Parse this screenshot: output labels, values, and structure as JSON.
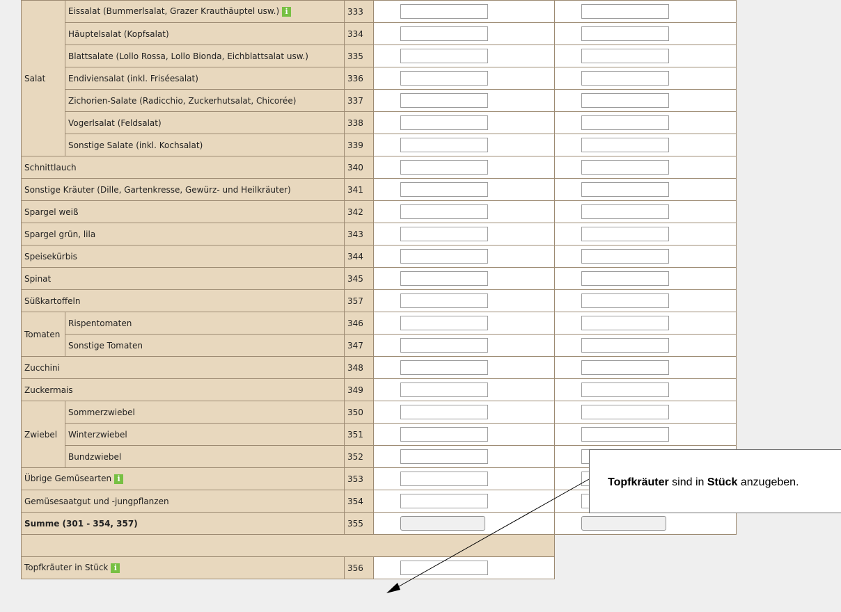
{
  "rows": {
    "salat": {
      "group_label": "Salat",
      "items": [
        {
          "label": "Eissalat (Bummerlsalat, Grazer Krauthäuptel usw.)",
          "info": "i",
          "code": "333"
        },
        {
          "label": "Häuptelsalat (Kopfsalat)",
          "code": "334"
        },
        {
          "label": "Blattsalate (Lollo Rossa, Lollo Bionda, Eichblattsalat usw.)",
          "code": "335"
        },
        {
          "label": "Endiviensalat (inkl. Friséesalat)",
          "code": "336"
        },
        {
          "label": "Zichorien-Salate (Radicchio, Zuckerhutsalat, Chicorée)",
          "code": "337"
        },
        {
          "label": "Vogerlsalat (Feldsalat)",
          "code": "338"
        },
        {
          "label": "Sonstige Salate (inkl. Kochsalat)",
          "code": "339"
        }
      ]
    },
    "singles_a": [
      {
        "label": "Schnittlauch",
        "code": "340"
      },
      {
        "label": "Sonstige Kräuter (Dille, Gartenkresse, Gewürz- und Heilkräuter)",
        "code": "341"
      },
      {
        "label": "Spargel weiß",
        "code": "342"
      },
      {
        "label": "Spargel grün, lila",
        "code": "343"
      },
      {
        "label": "Speisekürbis",
        "code": "344"
      },
      {
        "label": "Spinat",
        "code": "345"
      },
      {
        "label": "Süßkartoffeln",
        "code": "357"
      }
    ],
    "tomaten": {
      "group_label": "Tomaten",
      "items": [
        {
          "label": "Rispentomaten",
          "code": "346"
        },
        {
          "label": "Sonstige Tomaten",
          "code": "347"
        }
      ]
    },
    "singles_b": [
      {
        "label": "Zucchini",
        "code": "348"
      },
      {
        "label": "Zuckermais",
        "code": "349"
      }
    ],
    "zwiebel": {
      "group_label": "Zwiebel",
      "items": [
        {
          "label": "Sommerzwiebel",
          "code": "350"
        },
        {
          "label": "Winterzwiebel",
          "code": "351"
        },
        {
          "label": "Bundzwiebel",
          "code": "352"
        }
      ]
    },
    "singles_c": [
      {
        "label": "Übrige Gemüsearten",
        "info": "i",
        "code": "353"
      },
      {
        "label": "Gemüsesaatgut und -jungpflanzen",
        "code": "354"
      }
    ],
    "summe": {
      "label": "Summe (301 - 354, 357)",
      "code": "355"
    },
    "topf": {
      "label": "Topfkräuter in Stück",
      "info": "i",
      "code": "356"
    }
  },
  "callout": {
    "bold1": "Topfkräuter",
    "text1": " sind in ",
    "bold2": "Stück",
    "text2": " anzugeben."
  },
  "colors": {
    "label_bg": "#e8d8be",
    "border": "#9c8a72",
    "info_badge": "#77c043",
    "page_bg": "#efefef"
  }
}
